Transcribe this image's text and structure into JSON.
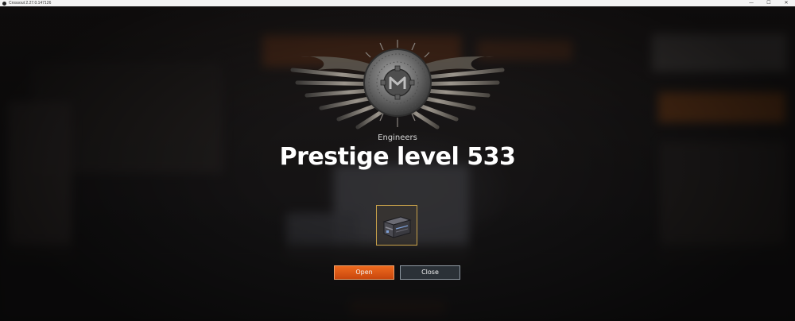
{
  "window": {
    "title": "Crossout 2.27.0.147126",
    "controls": {
      "minimize": "—",
      "maximize": "☐",
      "close": "✕"
    }
  },
  "dialog": {
    "faction_label": "Engineers",
    "headline": "Prestige level 533",
    "reward": {
      "icon": "container-crate-icon"
    },
    "buttons": {
      "open_label": "Open",
      "close_label": "Close"
    }
  },
  "colors": {
    "accent_orange": "#e0601a",
    "reward_border": "#c9a24a",
    "close_button": "#2b3137",
    "background_dark": "#1a1818"
  },
  "icons": {
    "emblem": "engineers-prestige-emblem-icon",
    "app": "crossout-app-icon"
  }
}
